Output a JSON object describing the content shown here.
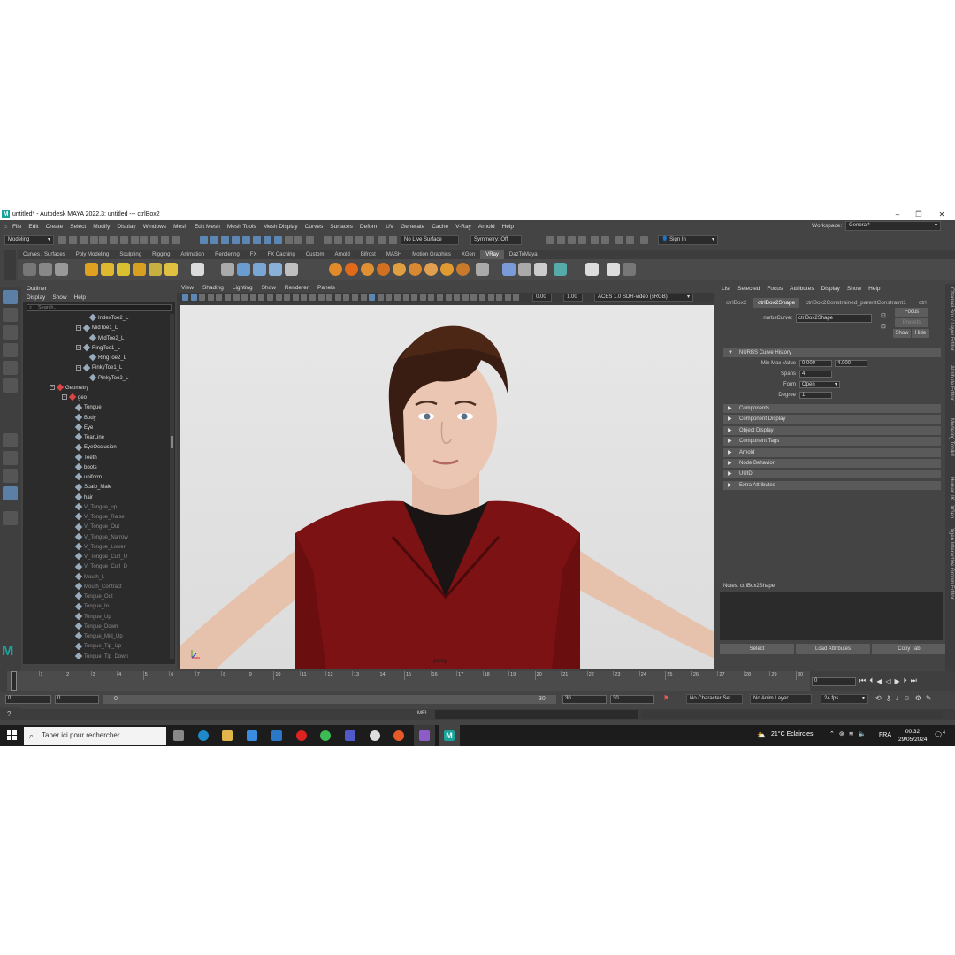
{
  "window": {
    "title": "untitled* - Autodesk MAYA 2022.3: untitled   ---   ctrlBox2"
  },
  "menus": [
    "File",
    "Edit",
    "Create",
    "Select",
    "Modify",
    "Display",
    "Windows",
    "Mesh",
    "Edit Mesh",
    "Mesh Tools",
    "Mesh Display",
    "Curves",
    "Surfaces",
    "Deform",
    "UV",
    "Generate",
    "Cache",
    "V-Ray",
    "Arnold",
    "Help"
  ],
  "workspace": {
    "label": "Workspace:",
    "value": "General*"
  },
  "toolbar": {
    "mode": "Modeling",
    "live_surface": "No Live Surface",
    "symmetry": "Symmetry: Off",
    "sign_in": "Sign In"
  },
  "shelf_tabs": [
    "Curves / Surfaces",
    "Poly Modeling",
    "Sculpting",
    "Rigging",
    "Animation",
    "Rendering",
    "FX",
    "FX Caching",
    "Custom",
    "Arnold",
    "Bifrost",
    "MASH",
    "Motion Graphics",
    "XGen",
    "VRay",
    "DazToMaya"
  ],
  "shelf_active": "VRay",
  "outliner": {
    "title": "Outliner",
    "menu": [
      "Display",
      "Show",
      "Help"
    ],
    "search_placeholder": "Search...",
    "items": [
      {
        "label": "IndexToe2_L",
        "indent": 3
      },
      {
        "label": "MidToe1_L",
        "indent": 2
      },
      {
        "label": "MidToe2_L",
        "indent": 3
      },
      {
        "label": "RingToe1_L",
        "indent": 2
      },
      {
        "label": "RingToe2_L",
        "indent": 3
      },
      {
        "label": "PinkyToe1_L",
        "indent": 2
      },
      {
        "label": "PinkyToe2_L",
        "indent": 3
      },
      {
        "label": "Geometry",
        "indent": 0
      },
      {
        "label": "geo",
        "indent": 1
      },
      {
        "label": "Tongue",
        "indent": 2
      },
      {
        "label": "Body",
        "indent": 2
      },
      {
        "label": "Eye",
        "indent": 2
      },
      {
        "label": "TearLine",
        "indent": 2
      },
      {
        "label": "EyeOcclusion",
        "indent": 2
      },
      {
        "label": "Teeth",
        "indent": 2
      },
      {
        "label": "boots",
        "indent": 2
      },
      {
        "label": "uniform",
        "indent": 2
      },
      {
        "label": "Scalp_Male",
        "indent": 2
      },
      {
        "label": "hair",
        "indent": 2
      },
      {
        "label": "V_Tongue_up",
        "indent": 2,
        "dim": true
      },
      {
        "label": "V_Tongue_Raise",
        "indent": 2,
        "dim": true
      },
      {
        "label": "V_Tongue_Out",
        "indent": 2,
        "dim": true
      },
      {
        "label": "V_Tongue_Narrow",
        "indent": 2,
        "dim": true
      },
      {
        "label": "V_Tongue_Lower",
        "indent": 2,
        "dim": true
      },
      {
        "label": "V_Tongue_Curl_U",
        "indent": 2,
        "dim": true
      },
      {
        "label": "V_Tongue_Curl_D",
        "indent": 2,
        "dim": true
      },
      {
        "label": "Mouth_L",
        "indent": 2,
        "dim": true
      },
      {
        "label": "Mouth_Contract",
        "indent": 2,
        "dim": true
      },
      {
        "label": "Tongue_Out",
        "indent": 2,
        "dim": true
      },
      {
        "label": "Tongue_In",
        "indent": 2,
        "dim": true
      },
      {
        "label": "Tongue_Up",
        "indent": 2,
        "dim": true
      },
      {
        "label": "Tongue_Down",
        "indent": 2,
        "dim": true
      },
      {
        "label": "Tongue_Mid_Up",
        "indent": 2,
        "dim": true
      },
      {
        "label": "Tongue_Tip_Up",
        "indent": 2,
        "dim": true
      },
      {
        "label": "Tongue_Tip_Down",
        "indent": 2,
        "dim": true
      }
    ]
  },
  "viewport": {
    "menu": [
      "View",
      "Shading",
      "Lighting",
      "Show",
      "Renderer",
      "Panels"
    ],
    "exposure": "0.00",
    "gamma": "1.00",
    "colorspace": "ACES 1.0 SDR-video (sRGB)",
    "camera_label": "persp"
  },
  "attribute_editor": {
    "menu": [
      "List",
      "Selected",
      "Focus",
      "Attributes",
      "Display",
      "Show",
      "Help"
    ],
    "tabs": [
      "ctrlBox2",
      "ctrlBox2Shape",
      "ctrlBox2Constrained_parentConstraint1",
      "ctrl"
    ],
    "active_tab": "ctrlBox2Shape",
    "node_label": "nurbsCurve:",
    "node_value": "ctrlBox2Shape",
    "focus_btn": "Focus",
    "presets_btn": "Presets",
    "show_btn": "Show",
    "hide_btn": "Hide",
    "section_history": "NURBS Curve History",
    "min_max_label": "Min Max Value",
    "min_value": "0.000",
    "max_value": "4.000",
    "spans_label": "Spans",
    "spans_value": "4",
    "form_label": "Form",
    "form_value": "Open",
    "degree_label": "Degree",
    "degree_value": "1",
    "sections": [
      "Components",
      "Component Display",
      "Object Display",
      "Component Tags",
      "Arnold",
      "Node Behavior",
      "UUID",
      "Extra Attributes"
    ],
    "notes_label": "Notes:  ctrlBox2Shape",
    "bottom_buttons": [
      "Select",
      "Load Attributes",
      "Copy Tab"
    ]
  },
  "side_tabs": [
    "Channel Box / Layer Editor",
    "Attribute Editor",
    "Modeling Toolkit",
    "Human IK",
    "XGen",
    "Xgen Interactive Groom Editor"
  ],
  "timeline": {
    "ticks": [
      0,
      1,
      2,
      3,
      4,
      5,
      6,
      7,
      8,
      9,
      10,
      11,
      12,
      13,
      14,
      15,
      16,
      17,
      18,
      19,
      20,
      21,
      22,
      23,
      24,
      25,
      26,
      27,
      28,
      29,
      30
    ],
    "current_frame_box": "0",
    "current": 0
  },
  "range": {
    "start": "0",
    "anim_start": "0",
    "slider_start": "0",
    "slider_end": "30",
    "anim_end": "30",
    "end": "30",
    "character_set": "No Character Set",
    "anim_layer": "No Anim Layer",
    "fps": "24 fps"
  },
  "command_line": {
    "mode": "MEL"
  },
  "taskbar": {
    "search_placeholder": "Taper ici pour rechercher",
    "weather": "21°C  Eclaircies",
    "lang": "FRA",
    "time": "00:32",
    "date": "29/05/2024",
    "notif_count": "4"
  }
}
